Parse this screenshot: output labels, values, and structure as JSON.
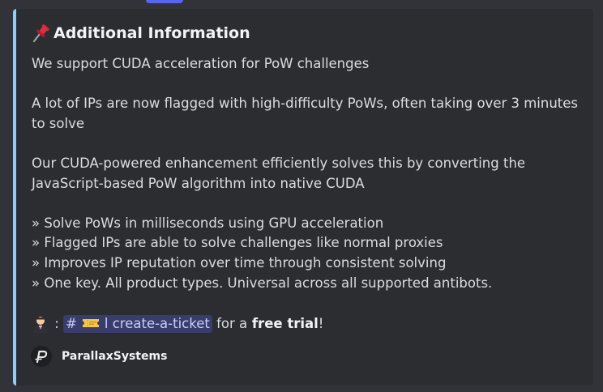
{
  "top_strip": {
    "ghost_text": "",
    "colors": {
      "mention_pill": "#5865f2"
    }
  },
  "embed": {
    "accent_color": "#89d0ff",
    "title_icon": "pushpin-icon",
    "title": "Additional Information",
    "body": {
      "p1": "We support CUDA acceleration for PoW challenges",
      "p2": "A lot of IPs are now flagged with high-difficulty PoWs, often taking over 3 minutes to solve",
      "p3": "Our CUDA-powered enhancement efficiently solves this by converting the JavaScript-based PoW algorithm into native CUDA",
      "bullets": [
        "» Solve PoWs in milliseconds using GPU acceleration",
        "» Flagged IPs are able to solve challenges like normal proxies",
        "» Improves IP reputation over time through consistent solving",
        "» One key. All product types. Universal across all supported antibots."
      ]
    },
    "cta": {
      "emoji_icon": "person-in-suit-emoji-icon",
      "separator": ":",
      "channel_hash": "#",
      "channel_icon": "ticket-icon",
      "channel_name": "l create-a-ticket",
      "text_before_bold": "for a",
      "bold_text": "free trial",
      "text_after_bold": "!"
    },
    "footer": {
      "avatar_icon": "parallax-logo-icon",
      "name": "ParallaxSystems"
    }
  }
}
